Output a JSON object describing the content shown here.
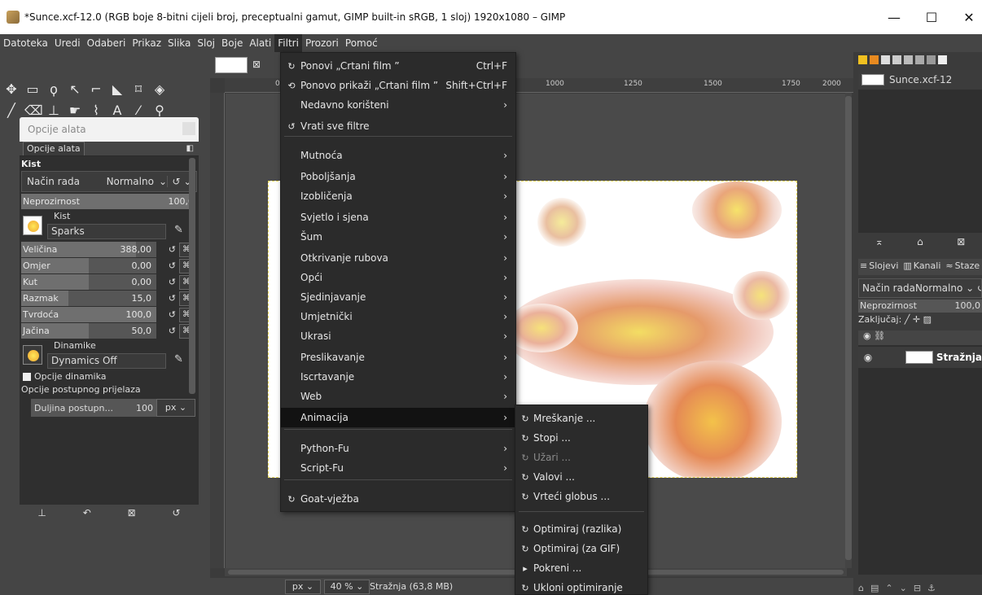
{
  "window": {
    "title": "*Sunce.xcf-12.0 (RGB boje 8-bitni cijeli broj, preceptualni gamut, GIMP built-in sRGB, 1 sloj) 1920x1080 – GIMP",
    "minimize": "—",
    "maximize": "☐",
    "close": "✕"
  },
  "menubar": {
    "items": [
      "Datoteka",
      "Uredi",
      "Odaberi",
      "Prikaz",
      "Slika",
      "Sloj",
      "Boje",
      "Alati",
      "Filtri",
      "Prozori",
      "Pomoć"
    ],
    "active": "Filtri"
  },
  "tool_options": {
    "header": "Opcije alata",
    "tab": "Opcije alata",
    "tool_name": "Kist",
    "mode_label": "Način rada",
    "mode_value": "Normalno",
    "opacity": {
      "label": "Neprozirnost",
      "value": "100,0",
      "fraction": 1.0
    },
    "brush_label": "Kist",
    "brush_name": "Sparks",
    "sliders": [
      {
        "label": "Veličina",
        "value": "388,00",
        "fraction": 0.85
      },
      {
        "label": "Omjer",
        "value": "0,00",
        "fraction": 0.5
      },
      {
        "label": "Kut",
        "value": "0,00",
        "fraction": 0.5
      },
      {
        "label": "Razmak",
        "value": "15,0",
        "fraction": 0.35
      },
      {
        "label": "Tvrdoća",
        "value": "100,0",
        "fraction": 1.0
      },
      {
        "label": "Jačina",
        "value": "50,0",
        "fraction": 0.5
      }
    ],
    "dynamics_label": "Dinamike",
    "dynamics_name": "Dynamics Off",
    "dynamics_options": "Opcije dinamika",
    "fade_options": "Opcije postupnog prijelaza",
    "fade_length_label": "Duljina postupn...",
    "fade_length_value": "100",
    "fade_unit": "px"
  },
  "canvas": {
    "ruler_marks": [
      "0",
      "1000",
      "1250",
      "1500",
      "1750",
      "2000"
    ],
    "status_unit": "px",
    "zoom": "40 %",
    "status_info": "Stražnja (63,8 MB)"
  },
  "images_dock": {
    "image_name": "Sunce.xcf-12"
  },
  "layers_dock": {
    "tabs": [
      "Slojevi",
      "Kanali",
      "Staze"
    ],
    "mode_label": "Način rada",
    "mode_value": "Normalno",
    "opacity_label": "Neprozirnost",
    "opacity_value": "100,0",
    "lock_label": "Zaključaj:",
    "layer_name": "Stražnja"
  },
  "filters_menu": {
    "items": [
      {
        "label": "Ponovi „Crtani film ”",
        "shortcut": "Ctrl+F",
        "icon": "↻"
      },
      {
        "label": "Ponovo prikaži „Crtani film ”",
        "shortcut": "Shift+Ctrl+F",
        "icon": "⟲"
      },
      {
        "label": "Nedavno korišteni",
        "arrow": "›"
      },
      {
        "label": "Vrati sve filtre",
        "icon": "↺"
      },
      {
        "label": "Mutnoća",
        "arrow": "›"
      },
      {
        "label": "Poboljšanja",
        "arrow": "›"
      },
      {
        "label": "Izobličenja",
        "arrow": "›"
      },
      {
        "label": "Svjetlo i sjena",
        "arrow": "›"
      },
      {
        "label": "Šum",
        "arrow": "›"
      },
      {
        "label": "Otkrivanje rubova",
        "arrow": "›"
      },
      {
        "label": "Opći",
        "arrow": "›"
      },
      {
        "label": "Sjedinjavanje",
        "arrow": "›"
      },
      {
        "label": "Umjetnički",
        "arrow": "›"
      },
      {
        "label": "Ukrasi",
        "arrow": "›"
      },
      {
        "label": "Preslikavanje",
        "arrow": "›"
      },
      {
        "label": "Iscrtavanje",
        "arrow": "›"
      },
      {
        "label": "Web",
        "arrow": "›"
      },
      {
        "label": "Animacija",
        "arrow": "›"
      },
      {
        "label": "Python-Fu",
        "arrow": "›"
      },
      {
        "label": "Script-Fu",
        "arrow": "›"
      },
      {
        "label": "Goat-vježba",
        "icon": "↻"
      }
    ],
    "highlighted": "Animacija"
  },
  "animation_submenu": {
    "items": [
      {
        "label": "Mreškanje ...",
        "icon": "↻",
        "disabled": false
      },
      {
        "label": "Stopi ...",
        "icon": "↻",
        "disabled": false
      },
      {
        "label": "Užari ...",
        "icon": "↻",
        "disabled": true
      },
      {
        "label": "Valovi ...",
        "icon": "↻",
        "disabled": false
      },
      {
        "label": "Vrteći globus ...",
        "icon": "↻",
        "disabled": false
      },
      {
        "label": "Optimiraj (razlika)",
        "icon": "↻",
        "disabled": false
      },
      {
        "label": "Optimiraj (za GIF)",
        "icon": "↻",
        "disabled": false
      },
      {
        "label": "Pokreni ...",
        "icon": "▸",
        "disabled": false
      },
      {
        "label": "Ukloni optimiranje",
        "icon": "↻",
        "disabled": false
      }
    ]
  }
}
